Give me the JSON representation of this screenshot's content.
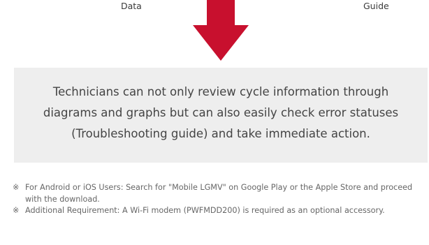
{
  "labels": {
    "left": "Data",
    "right": "Guide"
  },
  "arrow": {
    "color": "#c8102e",
    "icon": "down-arrow-icon"
  },
  "info_box": {
    "text": "Technicians can not only review cycle information through diagrams and graphs but can also easily check error statuses (Troubleshooting guide) and take immediate action."
  },
  "notes": [
    {
      "mark": "※",
      "text": "For Android or iOS Users: Search for \"Mobile LGMV\" on Google Play or the Apple Store and proceed with the download."
    },
    {
      "mark": "※",
      "text": "Additional Requirement: A Wi-Fi modem (PWFMDD200) is required as an optional accessory."
    }
  ]
}
